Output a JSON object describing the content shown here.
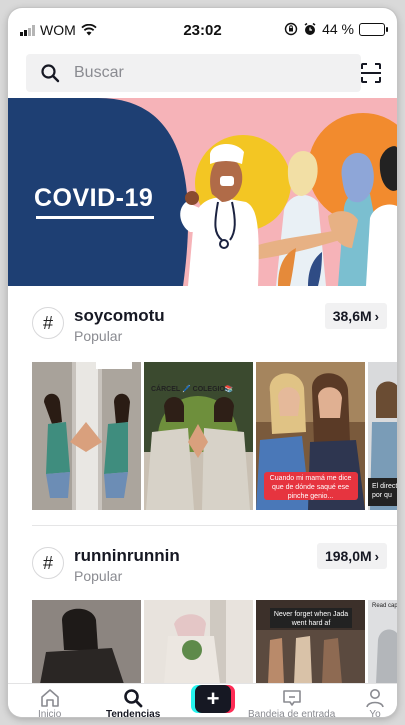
{
  "status_bar": {
    "carrier": "WOM",
    "time": "23:02",
    "battery_percent": "44 %",
    "battery_level": 0.44,
    "battery_color": "#f2d21f"
  },
  "search": {
    "placeholder": "Buscar",
    "icon": "search-icon",
    "scan_icon": "scan-icon"
  },
  "banner": {
    "title": "COVID-19",
    "background": "#f6b3b8",
    "page_count": 3,
    "active_page": 0
  },
  "hashtags": [
    {
      "name": "soycomotu",
      "subtitle": "Popular",
      "count": "38,6M",
      "thumbs": [
        {
          "label_top": "",
          "caption": ""
        },
        {
          "label_top": "CÁRCEL 🖊️  COLEGIO📚",
          "caption": ""
        },
        {
          "label_top": "",
          "caption": "Cuando mi mamá me dice que de dónde saqué ese pinche genio..."
        },
        {
          "label_top": "",
          "caption": "El direct por qu"
        }
      ]
    },
    {
      "name": "runninrunnin",
      "subtitle": "Popular",
      "count": "198,0M",
      "thumbs": [
        {
          "label_top": "",
          "caption": ""
        },
        {
          "label_top": "",
          "caption": ""
        },
        {
          "label_top": "Never forget when Jada went hard af",
          "caption": ""
        },
        {
          "label_top": "Read capti",
          "caption": ""
        }
      ]
    }
  ],
  "tabbar": {
    "home": "Inicio",
    "discover": "Tendencias",
    "inbox": "Bandeja de entrada",
    "profile": "Yo",
    "create": "+"
  },
  "colors": {
    "accent_red": "#fe2c55",
    "accent_cyan": "#25f4ee",
    "text_primary": "#161823",
    "text_secondary": "#8a8b91"
  }
}
